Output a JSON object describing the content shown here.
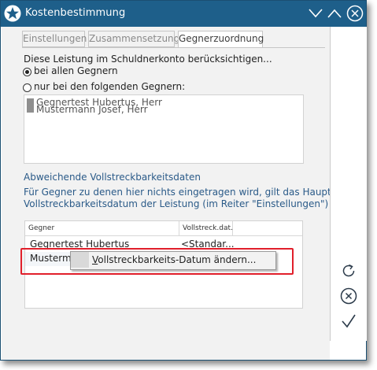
{
  "window": {
    "title": "Kostenbestimmung"
  },
  "tabs": [
    {
      "label": "Einstellungen",
      "active": false
    },
    {
      "label": "Zusammensetzung",
      "active": false
    },
    {
      "label": "Gegnerzuordnung",
      "active": true
    }
  ],
  "section1": {
    "heading": "Diese Leistung im Schuldnerkonto berücksichtigen...",
    "option_all": "bei allen Gegnern",
    "option_some": "nur bei den folgenden Gegnern:",
    "selected": "bei allen Gegnern",
    "opponents": [
      "Gegnertest Hubertus, Herr",
      "Mustermann Josef, Herr"
    ]
  },
  "section2": {
    "heading": "Abweichende Vollstreckbarkeitsdaten",
    "info_line1": "Für Gegner zu denen hier nichts eingetragen wird, gilt das Haupt -",
    "info_line2": "Vollstreckbarkeitsdatum der Leistung (im Reiter \"Einstellungen\")"
  },
  "grid": {
    "columns": [
      "Gegner",
      "Vollstreck.dat."
    ],
    "rows": [
      {
        "gegner": "Gegnertest Hubertus",
        "datum": "<Standar..."
      },
      {
        "gegner": "Musterma",
        "datum": ""
      }
    ]
  },
  "context_menu": {
    "items": [
      "Vollstreckbarkeits-Datum ändern..."
    ]
  },
  "colors": {
    "titlebar": "#1e5f8a",
    "accent_text": "#2a5a88",
    "highlight_box": "#e11f2b"
  },
  "icons": {
    "app": "star-icon",
    "minimize": "chevron-down-icon",
    "maximize": "chevron-up-icon",
    "close": "close-circle-icon",
    "refresh": "refresh-icon",
    "cancel": "cancel-circle-icon",
    "confirm": "checkmark-icon"
  }
}
